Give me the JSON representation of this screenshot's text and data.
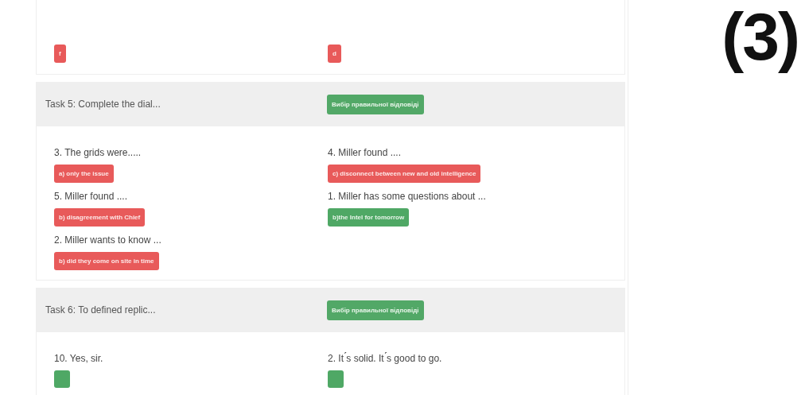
{
  "tasks": [
    {
      "items": [
        {
          "answer": {
            "text": "f",
            "correct": false
          }
        },
        {
          "answer": {
            "text": "d",
            "correct": false
          }
        }
      ]
    },
    {
      "title": "Task 5: Complete the dial...",
      "badge": "Вибір правильної відповіді",
      "items": [
        {
          "question": "3. The grids were.....",
          "answer": {
            "text": "a) only the issue",
            "correct": false
          }
        },
        {
          "question": "4. Miller found ....",
          "answer": {
            "text": "c) disconnect between new and old intelligence",
            "correct": false
          }
        },
        {
          "question": "5. Miller found ....",
          "answer": {
            "text": "b) disagreement with Chief",
            "correct": false
          }
        },
        {
          "question": "1. Miller has some questions about ...",
          "answer": {
            "text": "b)the Intel for tomorrow",
            "correct": true
          }
        },
        {
          "question": "2. Miller wants to know ...",
          "answer": {
            "text": "b) did they come on site in time",
            "correct": false
          }
        }
      ]
    },
    {
      "title": "Task 6: To defined replic...",
      "badge": "Вибір правильної відповіді",
      "items": [
        {
          "question": "10. Yes, sir.",
          "answer": {
            "correct": true
          }
        },
        {
          "question": "2. It ́s solid. It ́s good to go.",
          "answer": {
            "correct": true
          }
        }
      ]
    }
  ],
  "page_number": "(3)"
}
